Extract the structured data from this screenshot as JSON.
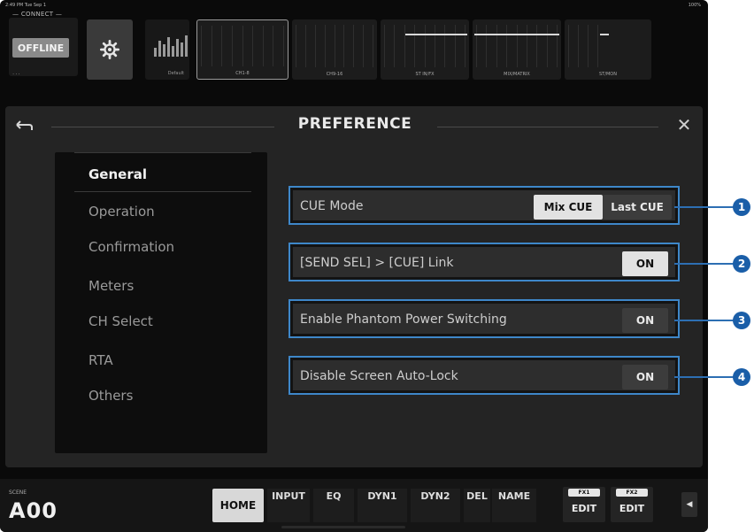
{
  "status": {
    "time": "2:49 PM  Tue Sep 1",
    "battery": "100%"
  },
  "top": {
    "connect_label": "— CONNECT —",
    "offline_label": "OFFLINE",
    "dots": "...",
    "default_label": "Default",
    "banks": [
      {
        "label": "CH1-8"
      },
      {
        "label": "CH9-16"
      },
      {
        "label": "ST IN/FX"
      },
      {
        "label": "MIX/MATRIX"
      },
      {
        "label": "ST/MON"
      }
    ]
  },
  "panel": {
    "title": "PREFERENCE",
    "sidebar": [
      {
        "label": "General"
      },
      {
        "label": "Operation"
      },
      {
        "label": "Confirmation"
      },
      {
        "label": "Meters"
      },
      {
        "label": "CH Select"
      },
      {
        "label": "RTA"
      },
      {
        "label": "Others"
      }
    ],
    "rows": [
      {
        "label": "CUE Mode",
        "buttons": [
          "Mix CUE",
          "Last CUE"
        ]
      },
      {
        "label": "[SEND SEL] > [CUE] Link",
        "buttons": [
          "ON"
        ]
      },
      {
        "label": "Enable Phantom Power Switching",
        "buttons": [
          "ON"
        ]
      },
      {
        "label": "Disable Screen Auto-Lock",
        "buttons": [
          "ON"
        ]
      }
    ],
    "callouts": [
      "1",
      "2",
      "3",
      "4"
    ]
  },
  "bottom": {
    "scene_label": "SCENE",
    "scene_value": "A00",
    "home": "HOME",
    "tabs": [
      "INPUT",
      "EQ",
      "DYN1",
      "DYN2",
      "DEL",
      "NAME"
    ],
    "fx": [
      {
        "tag": "FX1",
        "edit": "EDIT"
      },
      {
        "tag": "FX2",
        "edit": "EDIT"
      }
    ],
    "arrow": "◀"
  },
  "colors": {
    "accent": "#3e87c9",
    "callout": "#1a5ea8"
  }
}
